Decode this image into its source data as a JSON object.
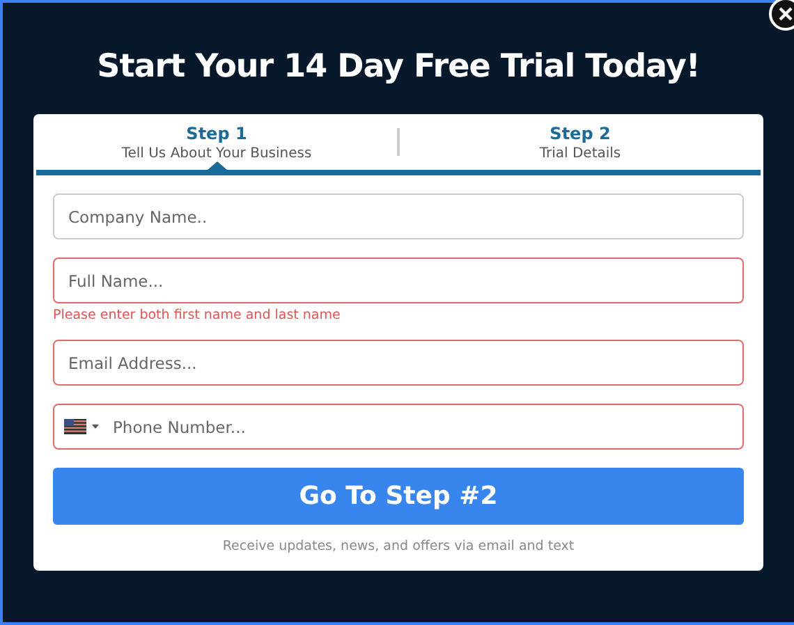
{
  "title": "Start Your 14 Day Free Trial Today!",
  "steps": [
    {
      "label": "Step 1",
      "caption": "Tell Us About Your Business",
      "selected": true
    },
    {
      "label": "Step 2",
      "caption": "Trial Details",
      "selected": false
    }
  ],
  "fields": [
    {
      "kind": "text",
      "placeholder": "Company Name..",
      "invalid": false
    },
    {
      "kind": "text",
      "placeholder": "Full Name...",
      "invalid": true,
      "error": "Please enter both first name and last name"
    },
    {
      "kind": "text",
      "placeholder": "Email Address...",
      "invalid": true
    },
    {
      "kind": "phone",
      "placeholder": "Phone Number...",
      "invalid": true
    }
  ],
  "button": "Go To Step #2",
  "note": "Receive updates, news, and offers via email and text"
}
